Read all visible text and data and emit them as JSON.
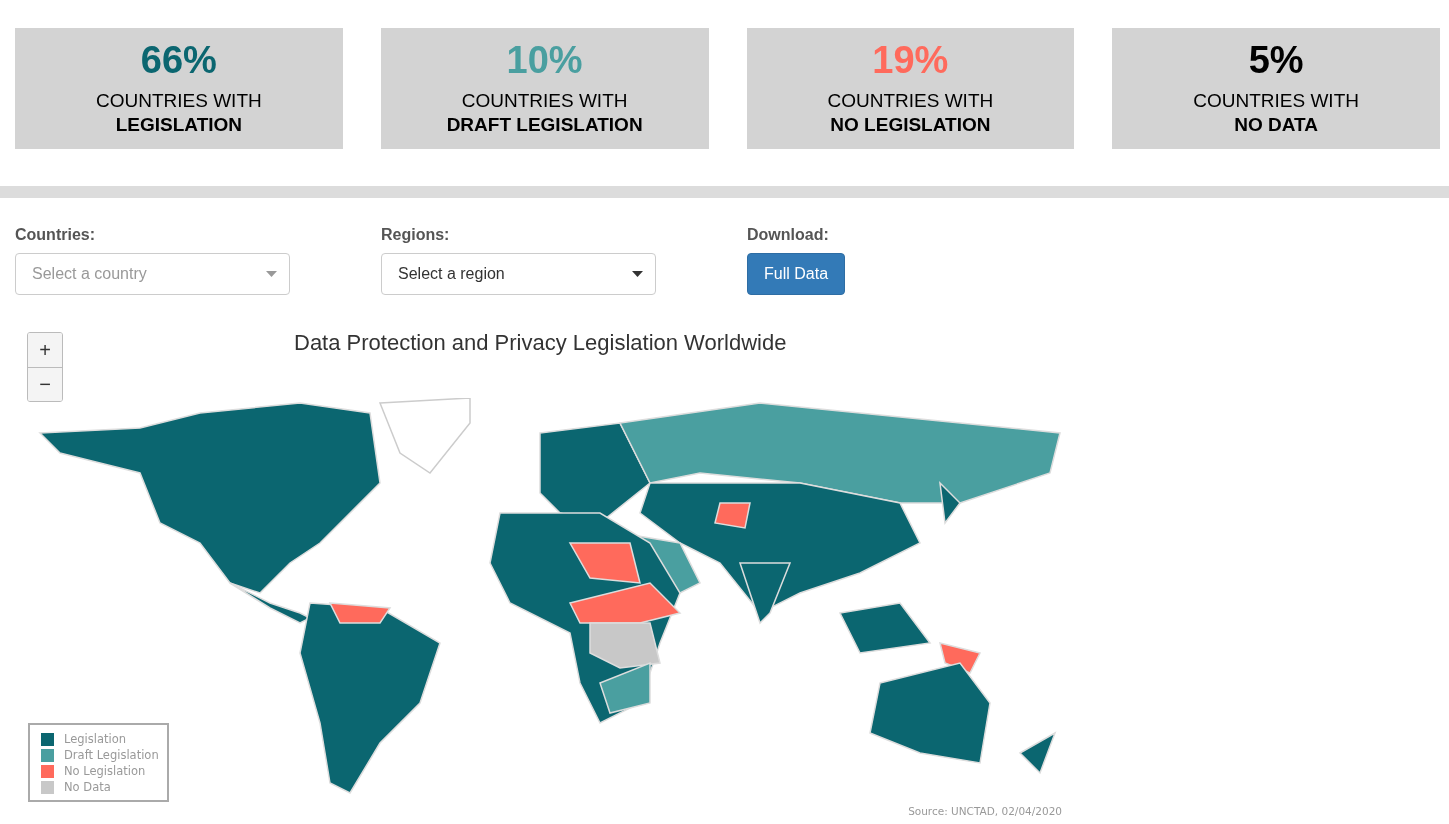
{
  "stats": [
    {
      "percent": "66%",
      "line1": "COUNTRIES WITH",
      "line2": "LEGISLATION",
      "color": "#0b6670"
    },
    {
      "percent": "10%",
      "line1": "COUNTRIES WITH",
      "line2": "DRAFT LEGISLATION",
      "color": "#4a9fa0"
    },
    {
      "percent": "19%",
      "line1": "COUNTRIES WITH",
      "line2": "NO LEGISLATION",
      "color": "#ff6a5c"
    },
    {
      "percent": "5%",
      "line1": "COUNTRIES WITH",
      "line2": "NO DATA",
      "color": "#000000"
    }
  ],
  "filters": [
    {
      "kind": "select",
      "label": "Countries:",
      "placeholder": "Select a country"
    },
    {
      "kind": "select",
      "label": "Regions:",
      "value": "Select a region"
    },
    {
      "kind": "button",
      "label": "Download:",
      "button": "Full Data"
    }
  ],
  "map": {
    "zoom_buttons": [
      "+",
      "−"
    ],
    "title": "Data Protection and Privacy Legislation Worldwide",
    "legend": [
      {
        "label": "Legislation",
        "color": "#0b6670"
      },
      {
        "label": "Draft Legislation",
        "color": "#4a9fa0"
      },
      {
        "label": "No Legislation",
        "color": "#ff6a5c"
      },
      {
        "label": "No Data",
        "color": "#c8c8c8"
      }
    ],
    "source": "Source: UNCTAD, 02/04/2020"
  }
}
